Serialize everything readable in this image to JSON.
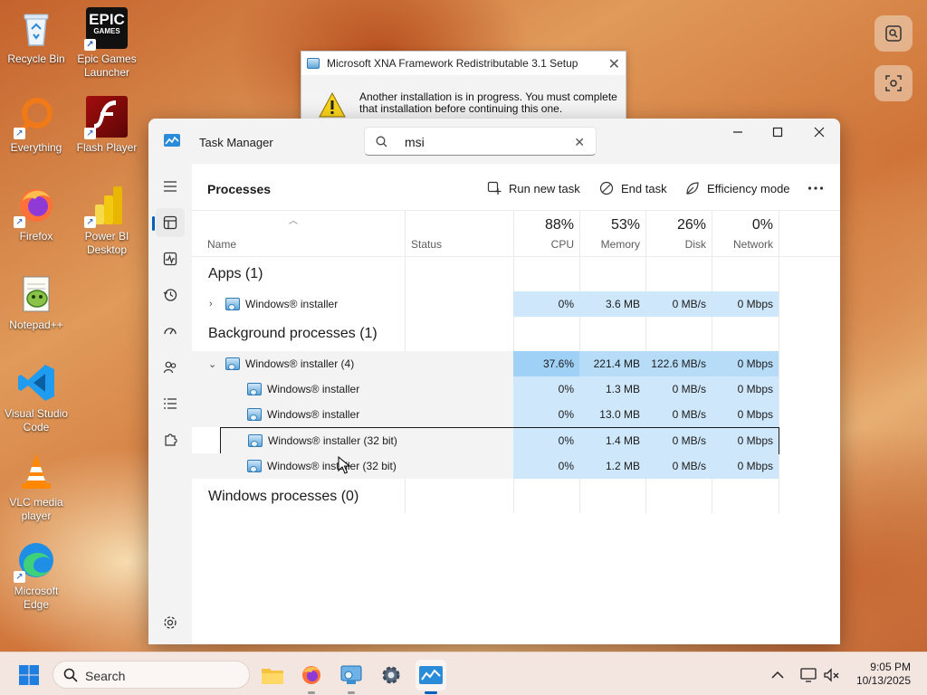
{
  "desktop": {
    "icons": [
      {
        "label": "Recycle Bin"
      },
      {
        "label": "Epic Games Launcher"
      },
      {
        "label": "Everything"
      },
      {
        "label": "Flash Player"
      },
      {
        "label": "Firefox"
      },
      {
        "label": "Power BI Desktop"
      },
      {
        "label": "Notepad++"
      },
      {
        "label": "Visual Studio Code"
      },
      {
        "label": "VLC media player"
      },
      {
        "label": "Microsoft Edge"
      }
    ],
    "epic_logo_text": [
      "EPIC",
      "GAMES"
    ]
  },
  "xna_dialog": {
    "title": "Microsoft XNA Framework Redistributable 3.1 Setup",
    "message_line1": "Another installation is in progress. You must complete",
    "message_line2": "that installation before continuing this one."
  },
  "task_manager": {
    "title": "Task Manager",
    "search_value": "msi",
    "page_title": "Processes",
    "toolbar": {
      "run_new_task": "Run new task",
      "end_task": "End task",
      "efficiency_mode": "Efficiency mode"
    },
    "columns": {
      "name": "Name",
      "status": "Status",
      "cpu_pct": "88%",
      "cpu": "CPU",
      "mem_pct": "53%",
      "mem": "Memory",
      "disk_pct": "26%",
      "disk": "Disk",
      "net_pct": "0%",
      "net": "Network"
    },
    "groups": {
      "apps": "Apps (1)",
      "background": "Background processes (1)",
      "windows": "Windows processes (0)"
    },
    "rows": [
      {
        "name": "Windows® installer",
        "cpu": "0%",
        "mem": "3.6 MB",
        "disk": "0 MB/s",
        "net": "0 Mbps"
      },
      {
        "name": "Windows® installer (4)",
        "cpu": "37.6%",
        "mem": "221.4 MB",
        "disk": "122.6 MB/s",
        "net": "0 Mbps"
      },
      {
        "name": "Windows® installer",
        "cpu": "0%",
        "mem": "1.3 MB",
        "disk": "0 MB/s",
        "net": "0 Mbps"
      },
      {
        "name": "Windows® installer",
        "cpu": "0%",
        "mem": "13.0 MB",
        "disk": "0 MB/s",
        "net": "0 Mbps"
      },
      {
        "name": "Windows® installer (32 bit)",
        "cpu": "0%",
        "mem": "1.4 MB",
        "disk": "0 MB/s",
        "net": "0 Mbps"
      },
      {
        "name": "Windows® installer (32 bit)",
        "cpu": "0%",
        "mem": "1.2 MB",
        "disk": "0 MB/s",
        "net": "0 Mbps"
      }
    ]
  },
  "taskbar": {
    "search_label": "Search",
    "time": "9:05 PM",
    "date": "10/13/2025"
  },
  "colors": {
    "accent": "#005fb8",
    "cpu_highlight": "#9fd0f5",
    "cell_highlight": "#cfe7fa"
  }
}
